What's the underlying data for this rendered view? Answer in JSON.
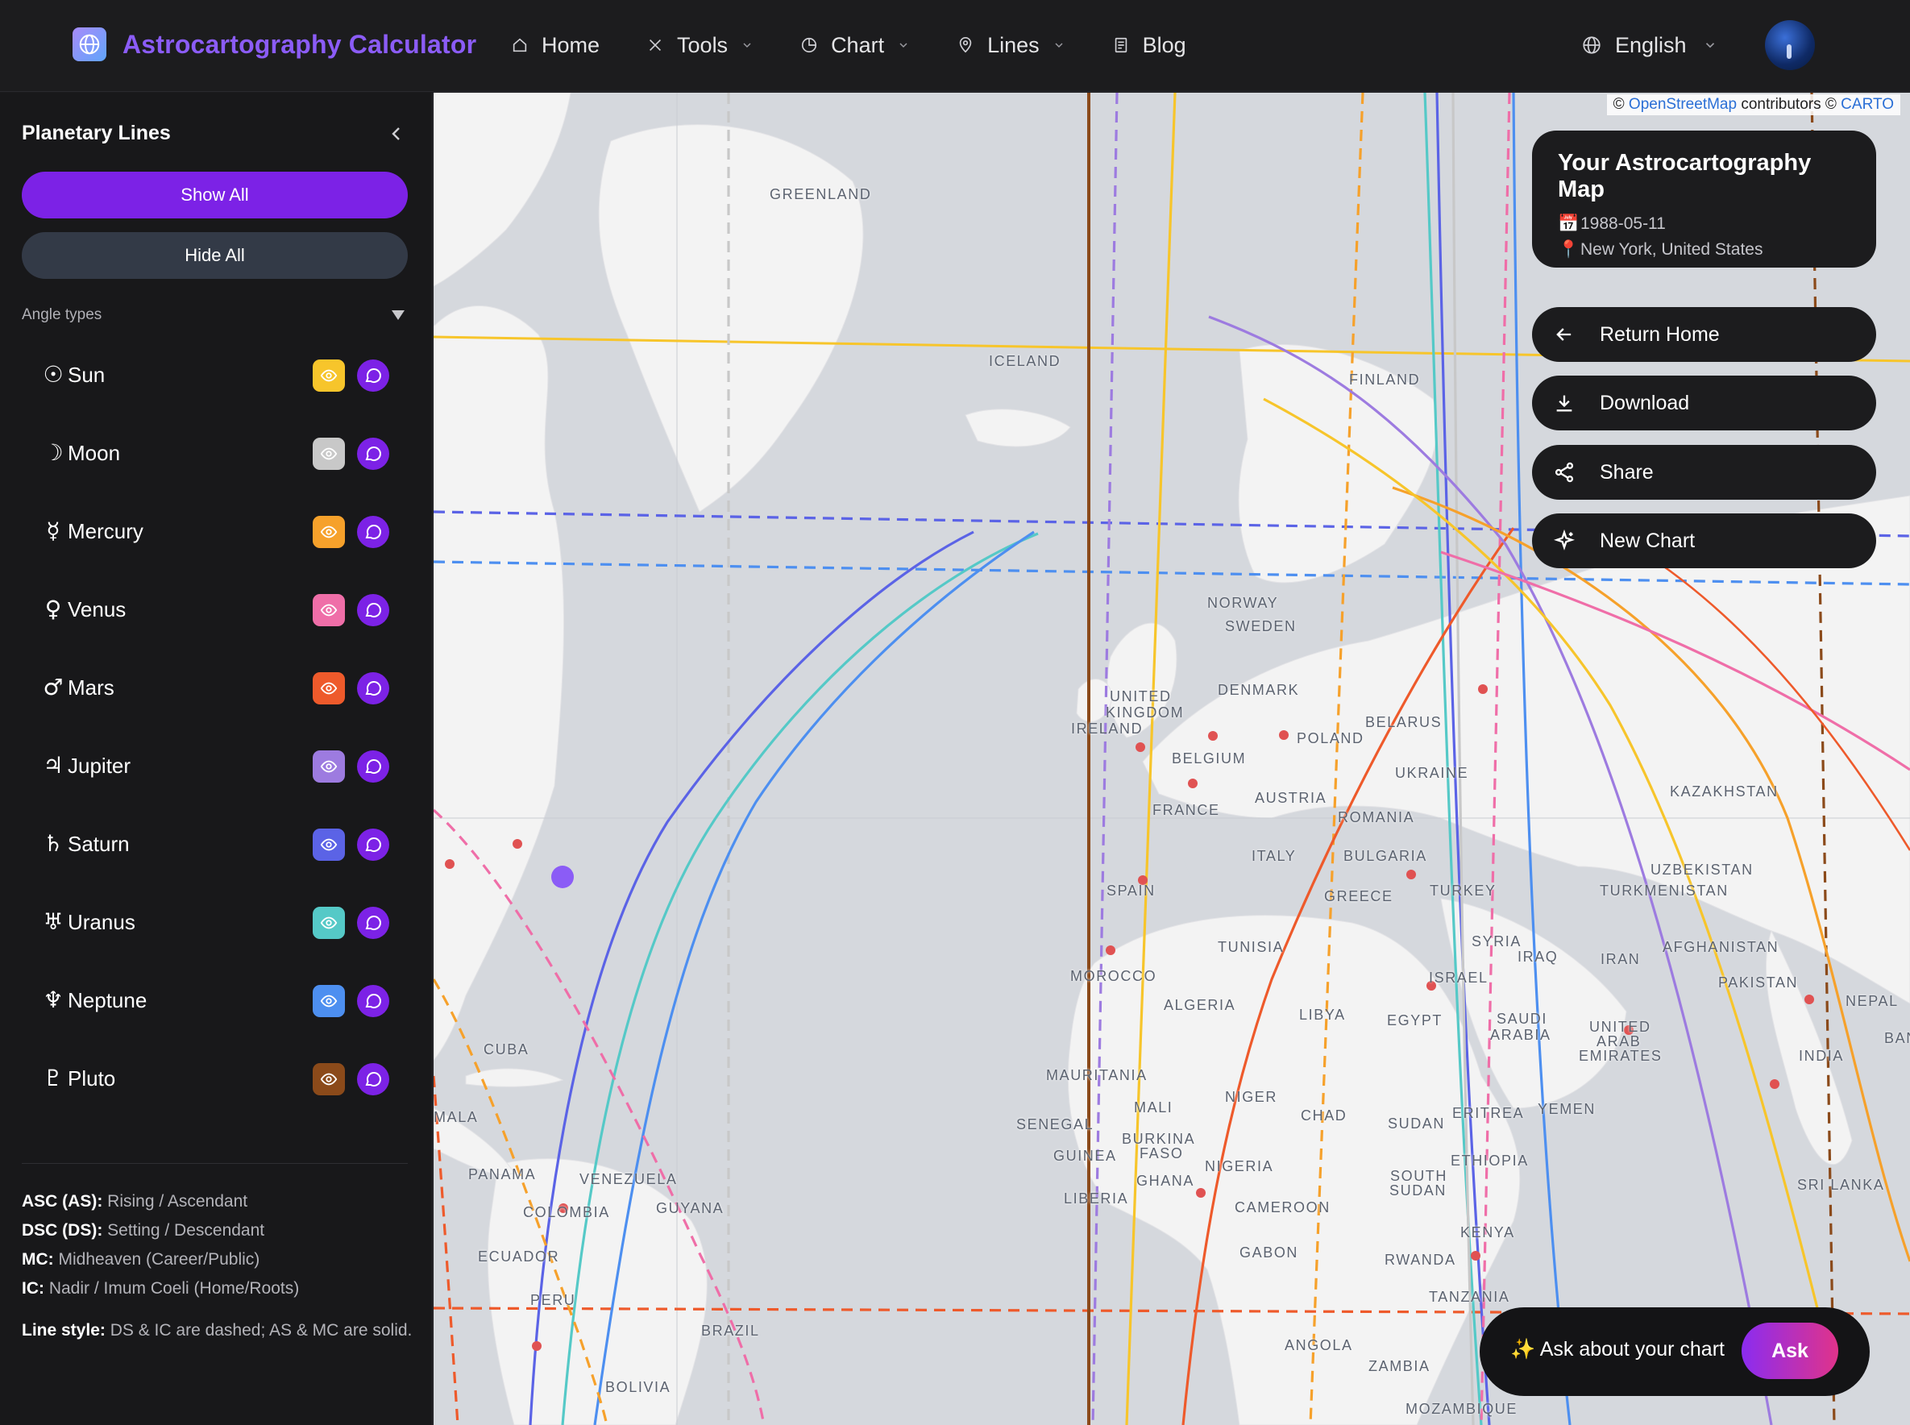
{
  "header": {
    "brand": "Astrocartography Calculator",
    "nav": [
      {
        "label": "Home",
        "icon": "home-icon",
        "dropdown": false
      },
      {
        "label": "Tools",
        "icon": "tools-icon",
        "dropdown": true
      },
      {
        "label": "Chart",
        "icon": "chart-icon",
        "dropdown": true
      },
      {
        "label": "Lines",
        "icon": "map-pin-icon",
        "dropdown": true
      },
      {
        "label": "Blog",
        "icon": "blog-icon",
        "dropdown": false
      }
    ],
    "language": "English"
  },
  "sidebar": {
    "title": "Planetary Lines",
    "show_all": "Show All",
    "hide_all": "Hide All",
    "angle_types": "Angle types",
    "planets": [
      {
        "symbol": "☉",
        "name": "Sun",
        "color": "#f7c52b"
      },
      {
        "symbol": "☽",
        "name": "Moon",
        "color": "#c8c8c8"
      },
      {
        "symbol": "☿",
        "name": "Mercury",
        "color": "#f6a12b"
      },
      {
        "symbol": "♀",
        "name": "Venus",
        "color": "#ef6ea8"
      },
      {
        "symbol": "♂",
        "name": "Mars",
        "color": "#ee5a2b"
      },
      {
        "symbol": "♃",
        "name": "Jupiter",
        "color": "#9d7be0"
      },
      {
        "symbol": "♄",
        "name": "Saturn",
        "color": "#5b63e6"
      },
      {
        "symbol": "♅",
        "name": "Uranus",
        "color": "#55c9c7"
      },
      {
        "symbol": "♆",
        "name": "Neptune",
        "color": "#4d8ff0"
      },
      {
        "symbol": "♇",
        "name": "Pluto",
        "color": "#8b4a1a"
      }
    ],
    "legend": [
      {
        "key": "ASC (AS):",
        "text": " Rising / Ascendant"
      },
      {
        "key": "DSC (DS):",
        "text": " Setting / Descendant"
      },
      {
        "key": "MC:",
        "text": " Midheaven (Career/Public)"
      },
      {
        "key": "IC:",
        "text": " Nadir / Imum Coeli (Home/Roots)"
      }
    ],
    "line_style": {
      "key": "Line style:",
      "text": " DS & IC are dashed; AS & MC are solid."
    }
  },
  "map": {
    "attribution": {
      "prefix": "© ",
      "osm": "OpenStreetMap",
      "middle": " contributors © ",
      "carto": "CARTO"
    },
    "labels": [
      {
        "text": "GREENLAND"
      },
      {
        "text": "ICELAND"
      },
      {
        "text": "FINLAND"
      },
      {
        "text": "NORWAY"
      },
      {
        "text": "SWEDEN"
      },
      {
        "text": "DENMARK"
      },
      {
        "text": "UNITED"
      },
      {
        "text": "KINGDOM"
      },
      {
        "text": "IRELAND"
      },
      {
        "text": "POLAND"
      },
      {
        "text": "BELARUS"
      },
      {
        "text": "BELGIUM"
      },
      {
        "text": "UKRAINE"
      },
      {
        "text": "FRANCE"
      },
      {
        "text": "AUSTRIA"
      },
      {
        "text": "ROMANIA"
      },
      {
        "text": "KAZAKHSTAN"
      },
      {
        "text": "ITALY"
      },
      {
        "text": "BULGARIA"
      },
      {
        "text": "SPAIN"
      },
      {
        "text": "GREECE"
      },
      {
        "text": "TURKEY"
      },
      {
        "text": "UZBEKISTAN"
      },
      {
        "text": "TURKMENISTAN"
      },
      {
        "text": "TUNISIA"
      },
      {
        "text": "SYRIA"
      },
      {
        "text": "IRAQ"
      },
      {
        "text": "IRAN"
      },
      {
        "text": "AFGHANISTAN"
      },
      {
        "text": "MOROCCO"
      },
      {
        "text": "ISRAEL"
      },
      {
        "text": "PAKISTAN"
      },
      {
        "text": "ALGERIA"
      },
      {
        "text": "LIBYA"
      },
      {
        "text": "EGYPT"
      },
      {
        "text": "SAUDI"
      },
      {
        "text": "ARABIA"
      },
      {
        "text": "UNITED"
      },
      {
        "text": "ARAB"
      },
      {
        "text": "EMIRATES"
      },
      {
        "text": "NEPAL"
      },
      {
        "text": "BAN"
      },
      {
        "text": "INDIA"
      },
      {
        "text": "CUBA"
      },
      {
        "text": "MAURITANIA"
      },
      {
        "text": "MALI"
      },
      {
        "text": "NIGER"
      },
      {
        "text": "CHAD"
      },
      {
        "text": "SUDAN"
      },
      {
        "text": "ERITREA"
      },
      {
        "text": "YEMEN"
      },
      {
        "text": "SENEGAL"
      },
      {
        "text": "BURKINA"
      },
      {
        "text": "FASO"
      },
      {
        "text": "GUINEA"
      },
      {
        "text": "GHANA"
      },
      {
        "text": "NIGERIA"
      },
      {
        "text": "ETHIOPIA"
      },
      {
        "text": "LIBERIA"
      },
      {
        "text": "SOUTH"
      },
      {
        "text": "SUDAN"
      },
      {
        "text": "MALA"
      },
      {
        "text": "PANAMA"
      },
      {
        "text": "VENEZUELA"
      },
      {
        "text": "GUYANA"
      },
      {
        "text": "COLOMBIA"
      },
      {
        "text": "CAMEROON"
      },
      {
        "text": "KENYA"
      },
      {
        "text": "ECUADOR"
      },
      {
        "text": "GABON"
      },
      {
        "text": "RWANDA"
      },
      {
        "text": "SRI LANKA"
      },
      {
        "text": "TANZANIA"
      },
      {
        "text": "PERU"
      },
      {
        "text": "BRAZIL"
      },
      {
        "text": "ANGOLA"
      },
      {
        "text": "ZAMBIA"
      },
      {
        "text": "BOLIVIA"
      },
      {
        "text": "MOZAMBIQUE"
      }
    ]
  },
  "info_card": {
    "title": "Your Astrocartography Map",
    "date_icon": "📅",
    "date": "1988-05-11",
    "place_icon": "📍",
    "place": "New York, United States"
  },
  "actions": [
    {
      "label": "Return Home",
      "icon": "arrow-left-icon"
    },
    {
      "label": "Download",
      "icon": "download-icon"
    },
    {
      "label": "Share",
      "icon": "share-icon"
    },
    {
      "label": "New Chart",
      "icon": "sparkle-icon"
    }
  ],
  "ask": {
    "prompt": "✨ Ask about your chart",
    "button": "Ask"
  }
}
